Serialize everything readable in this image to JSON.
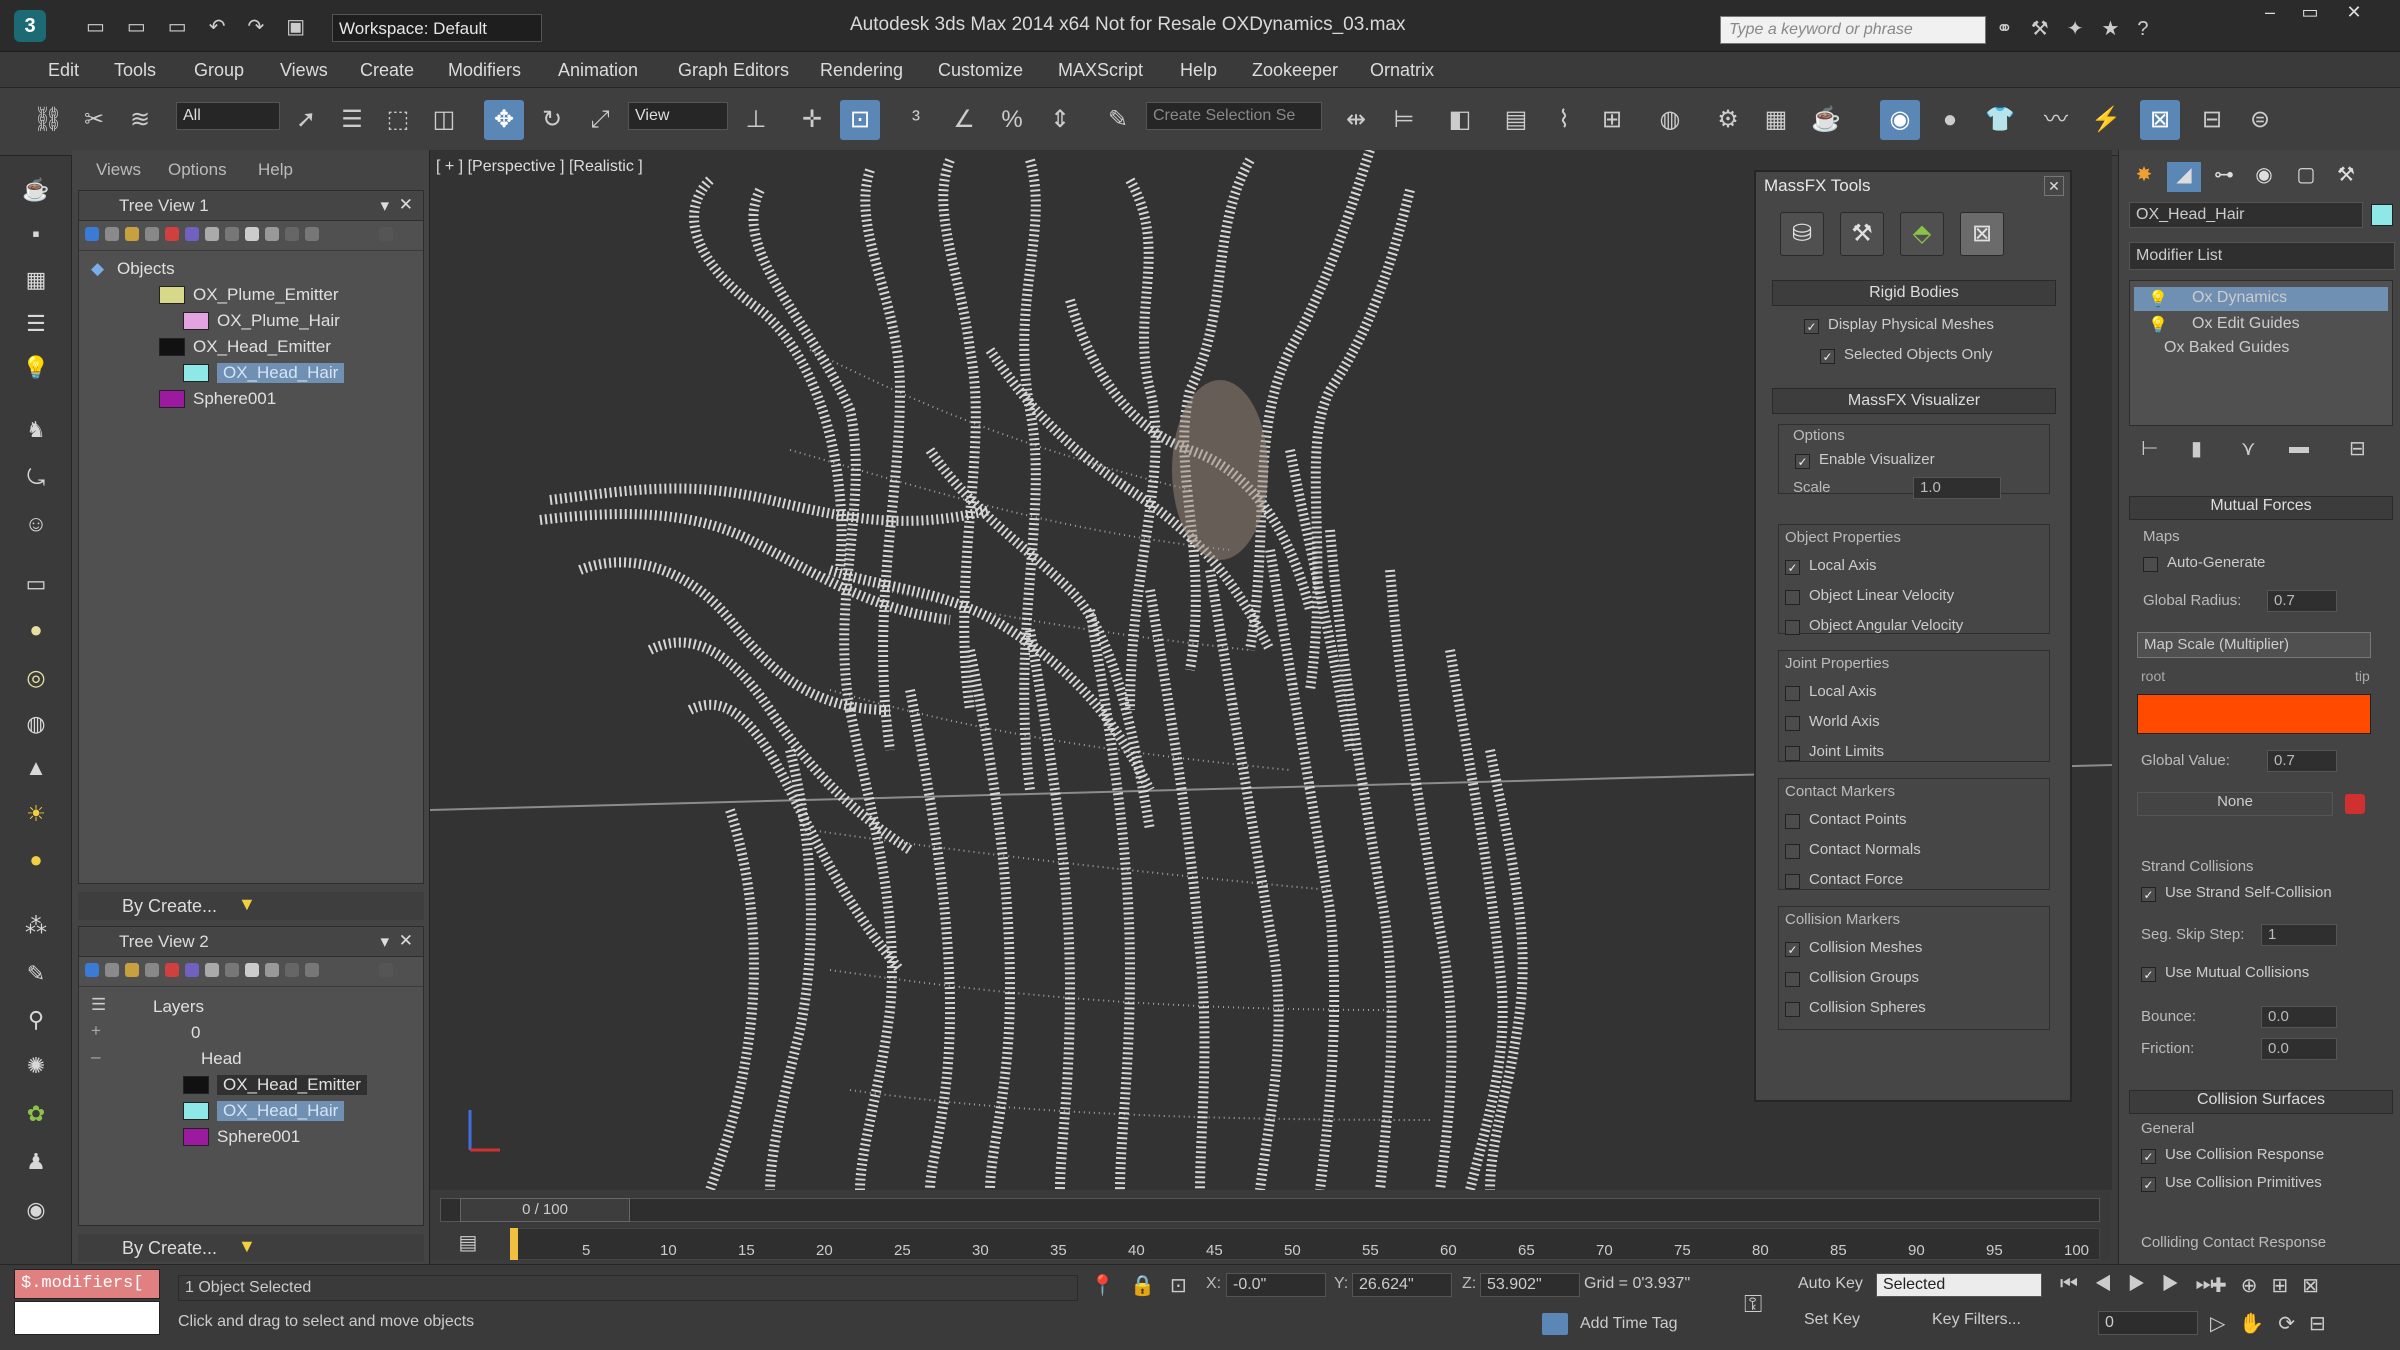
{
  "titlebar": {
    "app_title": "Autodesk 3ds Max  2014 x64    Not for Resale     OXDynamics_03.max",
    "workspace": "Workspace: Default",
    "search_placeholder": "Type a keyword or phrase"
  },
  "menu": [
    "Edit",
    "Tools",
    "Group",
    "Views",
    "Create",
    "Modifiers",
    "Animation",
    "Graph Editors",
    "Rendering",
    "Customize",
    "MAXScript",
    "Help",
    "Zookeeper",
    "Ornatrix"
  ],
  "toolbar": {
    "selection_filter": "All",
    "ref_coord": "View",
    "selection_set": "Create Selection Se"
  },
  "explorer": {
    "menu": [
      "Views",
      "Options",
      "Help"
    ],
    "tree1": {
      "title": "Tree View 1",
      "root": "Objects",
      "items": [
        {
          "label": "OX_Plume_Emitter",
          "color": "#d8d88a"
        },
        {
          "label": "OX_Plume_Hair",
          "color": "#e2a3e0"
        },
        {
          "label": "OX_Head_Emitter",
          "color": "#111111"
        },
        {
          "label": "OX_Head_Hair",
          "color": "#8ee8e8"
        },
        {
          "label": "Sphere001",
          "color": "#9c1aa0"
        }
      ],
      "footer": "By Create..."
    },
    "tree2": {
      "title": "Tree View 2",
      "root": "Layers",
      "layer0": "0",
      "layer_head": "Head",
      "items": [
        {
          "label": "OX_Head_Emitter",
          "color": "#111111"
        },
        {
          "label": "OX_Head_Hair",
          "color": "#8ee8e8"
        },
        {
          "label": "Sphere001",
          "color": "#9c1aa0"
        }
      ],
      "footer": "By Create..."
    }
  },
  "viewport": {
    "label": "[ + ] [Perspective ] [Realistic ]"
  },
  "massfx": {
    "title": "MassFX Tools",
    "rigid_bodies": "Rigid Bodies",
    "display_physical_meshes": "Display Physical Meshes",
    "selected_objects_only": "Selected Objects Only",
    "visualizer": "MassFX Visualizer",
    "options_title": "Options",
    "enable_visualizer": "Enable Visualizer",
    "scale_label": "Scale",
    "scale_value": "1.0",
    "object_properties": "Object Properties",
    "local_axis": "Local Axis",
    "object_linear_velocity": "Object Linear Velocity",
    "object_angular_velocity": "Object Angular Velocity",
    "joint_properties": "Joint Properties",
    "joint_local_axis": "Local Axis",
    "world_axis": "World Axis",
    "joint_limits": "Joint Limits",
    "contact_markers": "Contact Markers",
    "contact_points": "Contact Points",
    "contact_normals": "Contact Normals",
    "contact_force": "Contact Force",
    "collision_markers": "Collision Markers",
    "collision_meshes": "Collision Meshes",
    "collision_groups": "Collision Groups",
    "collision_spheres": "Collision Spheres"
  },
  "command_panel": {
    "object_name": "OX_Head_Hair",
    "modifier_list": "Modifier List",
    "stack": [
      "Ox Dynamics",
      "Ox Edit Guides",
      "Ox Baked Guides"
    ],
    "mutual_forces": "Mutual Forces",
    "maps": "Maps",
    "auto_generate": "Auto-Generate",
    "global_radius_label": "Global Radius:",
    "global_radius": "0.7",
    "map_scale": "Map Scale (Multiplier)",
    "root": "root",
    "tip": "tip",
    "global_value_label": "Global Value:",
    "global_value": "0.7",
    "none": "None",
    "strand_collisions": "Strand Collisions",
    "use_strand_self_collision": "Use Strand Self-Collision",
    "seg_skip_label": "Seg. Skip Step:",
    "seg_skip": "1",
    "use_mutual_collisions": "Use Mutual Collisions",
    "bounce_label": "Bounce:",
    "bounce": "0.0",
    "friction_label": "Friction:",
    "friction": "0.0",
    "collision_surfaces": "Collision Surfaces",
    "general": "General",
    "use_collision_response": "Use Collision Response",
    "use_collision_primitives": "Use Collision Primitives",
    "colliding_contact_response": "Colliding Contact Response",
    "ramp_color": "#ff4a00"
  },
  "timeline": {
    "frame": "0 / 100",
    "ticks": [
      "5",
      "10",
      "15",
      "20",
      "25",
      "30",
      "35",
      "40",
      "45",
      "50",
      "55",
      "60",
      "65",
      "70",
      "75",
      "80",
      "85",
      "90",
      "95",
      "100"
    ]
  },
  "status": {
    "maxscript": "$.modifiers[",
    "selected": "1 Object Selected",
    "prompt": "Click and drag to select and move objects",
    "x": "-0.0\"",
    "y": "26.624\"",
    "z": "53.902\"",
    "grid": "Grid = 0'3.937\"",
    "auto_key": "Auto Key",
    "set_key": "Set Key",
    "key_mode": "Selected",
    "key_filters": "Key Filters...",
    "add_time_tag": "Add Time Tag",
    "frame_field": "0"
  }
}
